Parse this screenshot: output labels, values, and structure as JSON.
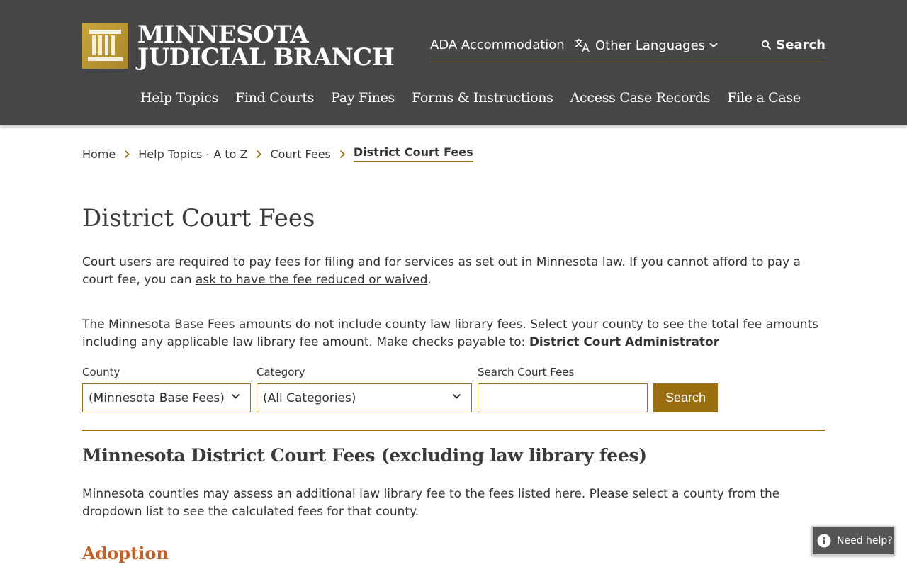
{
  "header": {
    "logo_line1": "MINNESOTA",
    "logo_line2": "JUDICIAL BRANCH",
    "utility": {
      "ada": "ADA Accommodation",
      "languages": "Other Languages",
      "search": "Search"
    },
    "nav": [
      "Help Topics",
      "Find Courts",
      "Pay Fines",
      "Forms & Instructions",
      "Access Case Records",
      "File a Case"
    ]
  },
  "breadcrumb": {
    "items": [
      "Home",
      "Help Topics - A to Z",
      "Court Fees"
    ],
    "current": "District Court Fees"
  },
  "page": {
    "title": "District Court Fees",
    "intro_text": "Court users are required to pay fees for filing and for services as set out in Minnesota law.  If you cannot afford to pay a court fee, you can ",
    "intro_link": "ask to have the fee reduced or waived",
    "intro_end": ".",
    "base_fees_text": "The Minnesota Base Fees amounts do not include county law library fees. Select your county to see the total fee amounts including any applicable law library fee amount. Make checks payable to: ",
    "payable_to": "District Court Administrator"
  },
  "filters": {
    "county_label": "County",
    "county_value": "(Minnesota Base Fees)",
    "category_label": "Category",
    "category_value": "(All Categories)",
    "search_label": "Search Court Fees",
    "search_value": "",
    "search_button": "Search"
  },
  "section": {
    "title": "Minnesota District Court Fees (excluding law library fees)",
    "text": "Minnesota counties may assess an additional law library fee to the fees listed here. Please select a county from the dropdown list to see the calculated fees for that county.",
    "subsection": "Adoption"
  },
  "help_widget": {
    "label": "Need help?"
  },
  "colors": {
    "header_bg": "#464646",
    "gold": "#9a7119",
    "button_bg": "#9a6f12",
    "subsection": "#c0622a"
  }
}
